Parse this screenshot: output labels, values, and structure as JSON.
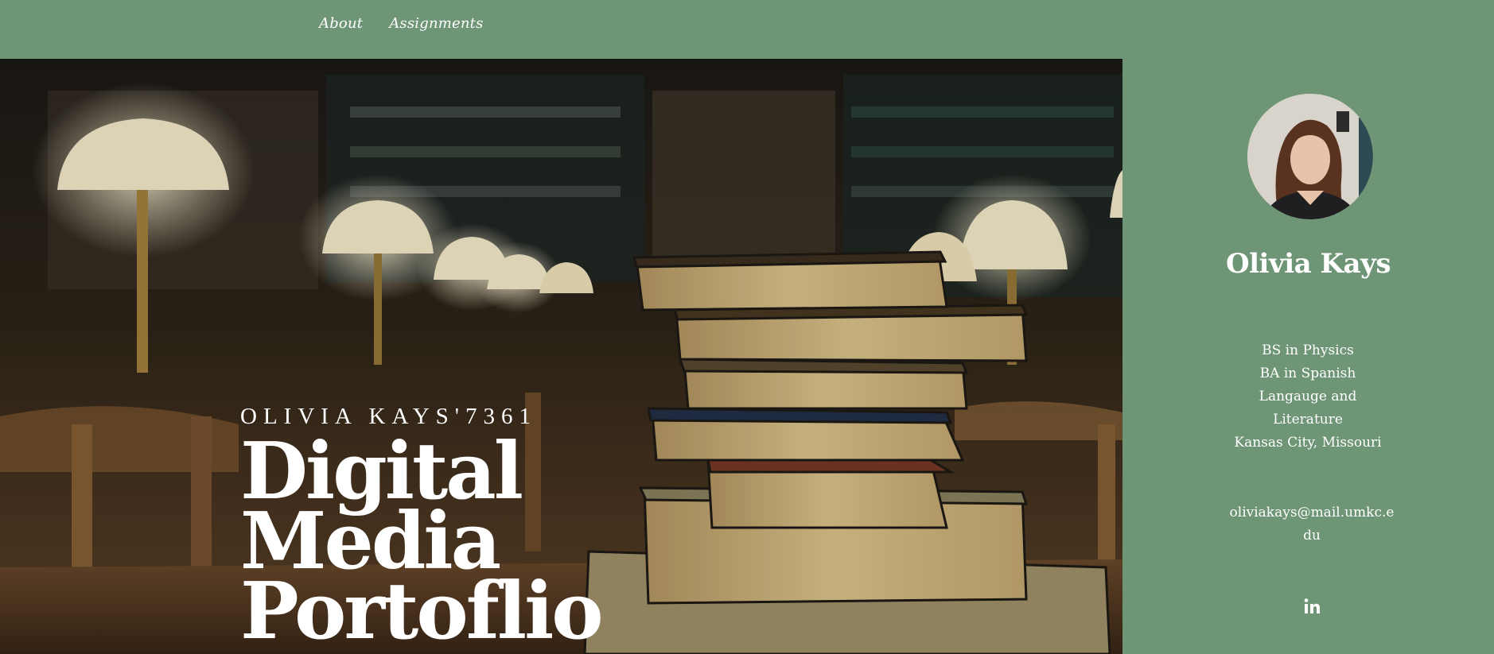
{
  "nav": {
    "items": [
      {
        "label": "About"
      },
      {
        "label": "Assignments"
      }
    ]
  },
  "hero": {
    "subtitle": "OLIVIA KAYS'7361",
    "title_lines": [
      "Digital",
      "Media",
      "Portoflio"
    ],
    "image": "library-books-photo"
  },
  "sidebar": {
    "avatar": "profile-photo",
    "name": "Olivia Kays",
    "bio_lines": [
      "BS in Physics",
      "BA in Spanish",
      "Langauge and",
      "Literature",
      "Kansas City, Missouri"
    ],
    "email": "oliviakays@mail.umkc.edu",
    "social": [
      {
        "icon": "linkedin-icon"
      }
    ]
  },
  "colors": {
    "background": "#6e9576",
    "text": "#ffffff"
  }
}
